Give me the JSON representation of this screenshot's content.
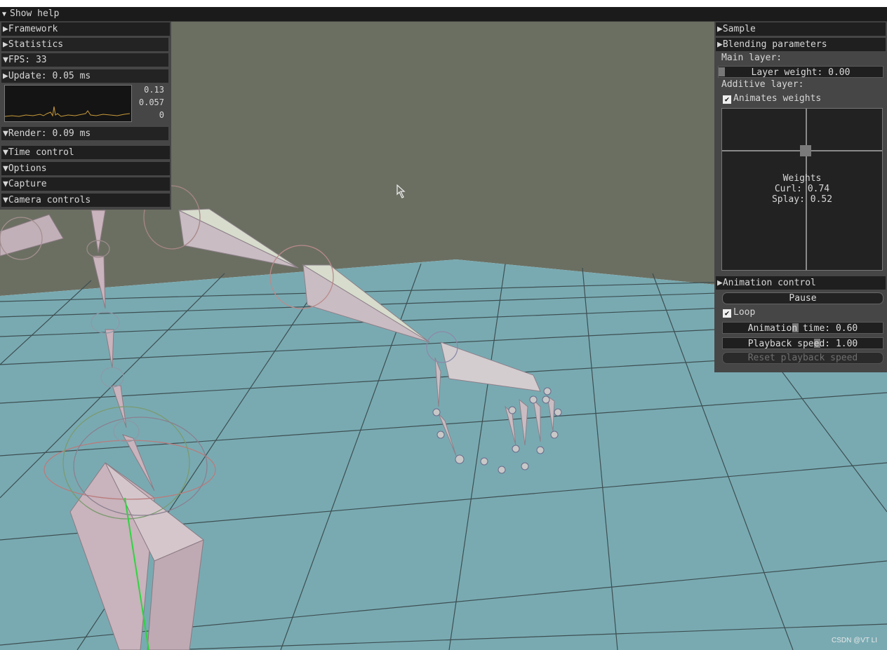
{
  "help_bar": {
    "label": "Show help"
  },
  "left_panel": {
    "framework": "Framework",
    "statistics": "Statistics",
    "fps": "FPS: 33",
    "update": "Update: 0.05 ms",
    "graph_max": "0.13",
    "graph_mid": "0.057",
    "graph_min": "0",
    "render": "Render: 0.09 ms",
    "time_control": "Time control",
    "options": "Options",
    "capture": "Capture",
    "camera_controls": "Camera controls"
  },
  "right_panel": {
    "sample": "Sample",
    "blending_parameters": "Blending parameters",
    "main_layer": "Main layer:",
    "layer_weight": "Layer weight: 0.00",
    "layer_weight_value": 0.0,
    "additive_layer": "Additive layer:",
    "animates_weights": "Animates weights",
    "animates_weights_checked": true,
    "weights_title": "Weights",
    "curl": "Curl: 0.74",
    "splay": "Splay: 0.52",
    "animation_control": "Animation control",
    "pause": "Pause",
    "loop": "Loop",
    "loop_checked": true,
    "animation_time": "Animation time: 0.60",
    "animation_time_value": 0.6,
    "playback_speed": "Playback speed: 1.00",
    "reset_playback_speed": "Reset playback speed"
  },
  "watermark": "CSDN @VT LI",
  "colors": {
    "floor": "#79aab2",
    "wall": "#6b6f62",
    "bone": "#c8b8be",
    "panel_bg": "#464646"
  }
}
